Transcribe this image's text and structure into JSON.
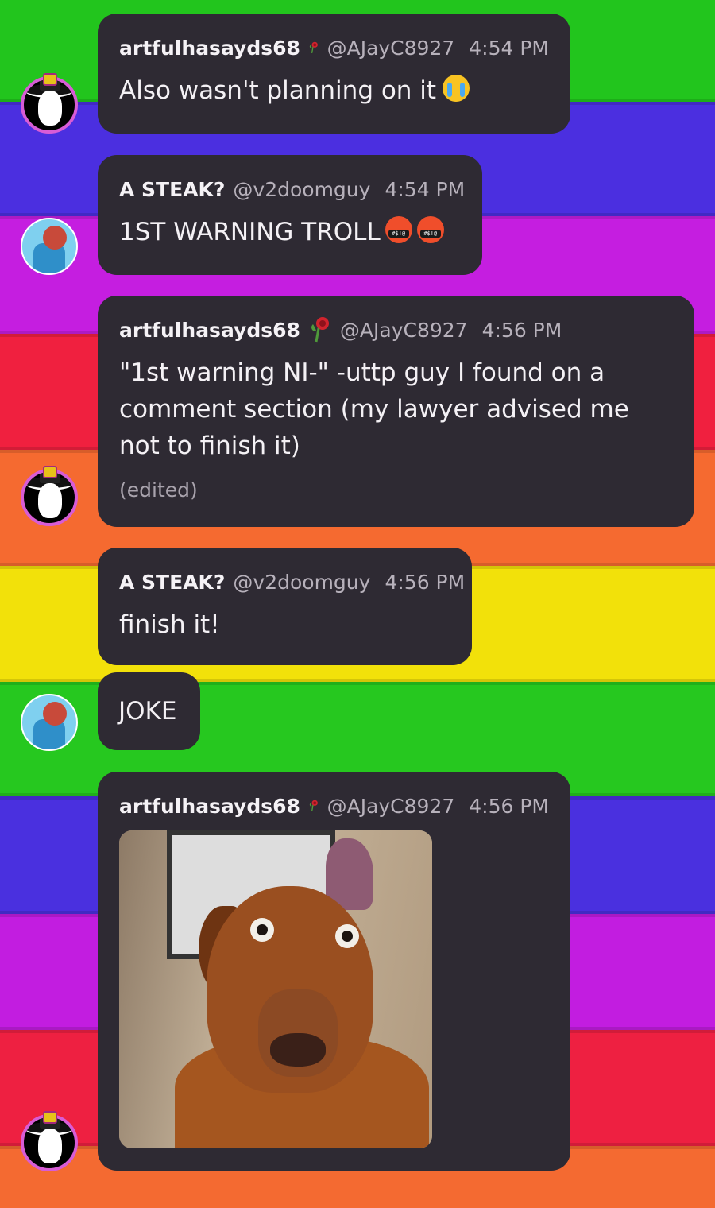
{
  "messages": [
    {
      "username": "artfulhasayds68",
      "handle": "@AJayC8927",
      "time": "4:54 PM",
      "text": "Also wasn't planning on it",
      "emoji": "crying-face"
    },
    {
      "username": "A STEAK?",
      "handle": "@v2doomguy",
      "time": "4:54 PM",
      "text": "1ST WARNING TROLL",
      "emoji": "swearing-face",
      "emoji_text": "#$!@"
    },
    {
      "username": "artfulhasayds68",
      "handle": "@AJayC8927",
      "time": "4:56 PM",
      "text": "\"1st warning NI-\" -uttp guy I found on a comment section (my lawyer advised me not to finish it)",
      "edited": "(edited)"
    },
    {
      "username": "A STEAK?",
      "handle": "@v2doomguy",
      "time": "4:56 PM",
      "text": "finish it!"
    },
    {
      "text": "JOKE"
    },
    {
      "username": "artfulhasayds68",
      "handle": "@AJayC8927",
      "time": "4:56 PM",
      "attachment": "shocked-dog-gif"
    }
  ],
  "colors": {
    "bubble": "#2e2a33",
    "text": "#f4f1f5",
    "muted": "#b7b1bb"
  },
  "icons": {
    "badge": "rose-icon",
    "avatar_art": "cowboy-avatar",
    "avatar_steak": "steak-avatar"
  }
}
